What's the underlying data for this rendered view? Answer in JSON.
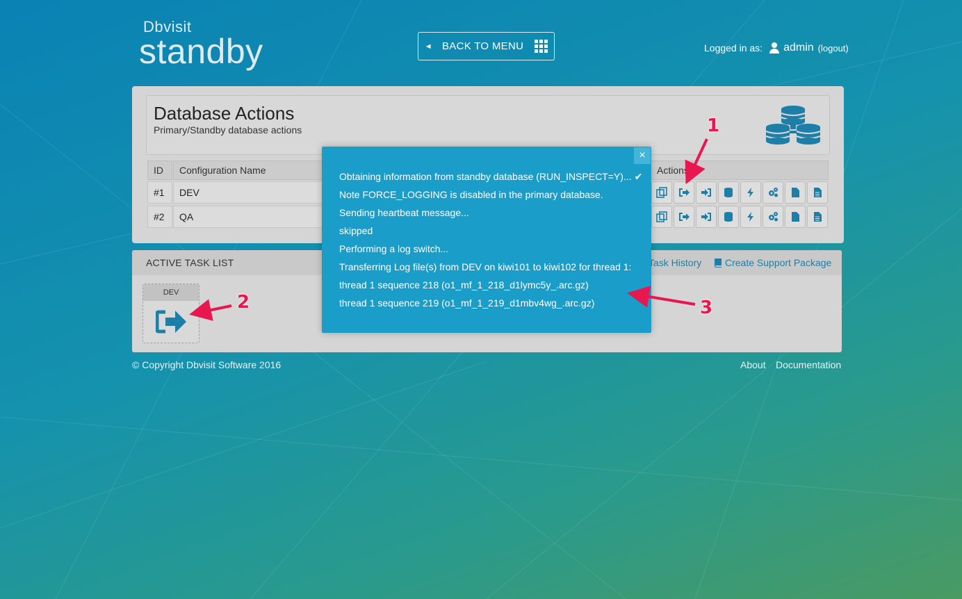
{
  "header": {
    "logo_top": "Dbvisit",
    "logo_bottom": "standby",
    "back_button": "BACK TO MENU",
    "logged_in_label": "Logged in as:",
    "username": "admin",
    "logout": "(logout)"
  },
  "panel": {
    "title": "Database Actions",
    "subtitle": "Primary/Standby database actions",
    "columns": {
      "id": "ID",
      "config_name": "Configuration Name",
      "actions": "Actions"
    },
    "rows": [
      {
        "id": "#1",
        "name": "DEV"
      },
      {
        "id": "#2",
        "name": "QA"
      }
    ]
  },
  "tasks": {
    "title": "ACTIVE TASK LIST",
    "history_link": "Task History",
    "support_link": "Create Support Package",
    "card_label": "DEV"
  },
  "footer": {
    "copyright": "© Copyright Dbvisit Software 2016",
    "about": "About",
    "documentation": "Documentation"
  },
  "modal": {
    "close": "×",
    "lines": [
      "Obtaining information from standby database (RUN_INSPECT=Y)...",
      "Note FORCE_LOGGING is disabled in the primary database.",
      "Sending heartbeat message...",
      "skipped",
      "Performing a log switch...",
      "Transferring Log file(s) from DEV on kiwi101 to kiwi102 for thread 1:",
      "thread 1 sequence 218 (o1_mf_1_218_d1lymc5y_.arc.gz)",
      "thread 1 sequence 219 (o1_mf_1_219_d1mbv4wg_.arc.gz)"
    ]
  },
  "annotations": {
    "a1": "1",
    "a2": "2",
    "a3": "3"
  },
  "colors": {
    "accent": "#1d7fa8",
    "modal_bg": "#1a9ec9",
    "annotation": "#e8174f"
  }
}
